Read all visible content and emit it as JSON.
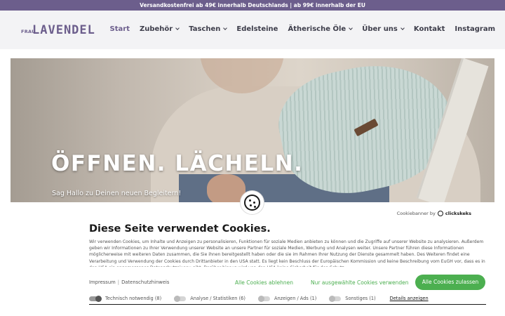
{
  "topbar": {
    "text": "Versandkostenfrei ab 49€ innerhalb Deutschlands | ab 99€ innerhalb der EU"
  },
  "logo": {
    "prefix": "FRAU",
    "name": "LAVENDEL"
  },
  "nav": {
    "items": [
      {
        "label": "Start",
        "active": true,
        "dropdown": false
      },
      {
        "label": "Zubehör",
        "active": false,
        "dropdown": true
      },
      {
        "label": "Taschen",
        "active": false,
        "dropdown": true
      },
      {
        "label": "Edelsteine",
        "active": false,
        "dropdown": false
      },
      {
        "label": "Ätherische Öle",
        "active": false,
        "dropdown": true
      },
      {
        "label": "Über uns",
        "active": false,
        "dropdown": true
      },
      {
        "label": "Kontakt",
        "active": false,
        "dropdown": false
      },
      {
        "label": "Instagram",
        "active": false,
        "dropdown": false
      }
    ]
  },
  "hero": {
    "headline": "ÖFFNEN. LÄCHELN.",
    "subline": "Sag Hallo zu Deinen neuen Begleitern!"
  },
  "cookie_banner": {
    "brand_prefix": "Cookiebanner by",
    "brand_name": "clickskeks",
    "title": "Diese Seite verwendet Cookies.",
    "body": "Wir verwenden Cookies, um Inhalte und Anzeigen zu personalisieren, Funktionen für soziale Medien anbieten zu können und die Zugriffe auf unserer Website zu analysieren. Außerdem geben wir Informationen zu Ihrer Verwendung unserer Website an unsere Partner für soziale Medien, Werbung und Analysen weiter. Unsere Partner führen diese Informationen möglicherweise mit weiteren Daten zusammen, die Sie ihnen bereitgestellt haben oder die sie im Rahmen Ihrer Nutzung der Dienste gesammelt haben. Des Weiteren findet eine Verarbeitung und Verwendung der Cookies durch Drittanbieter in den USA statt. Es liegt kein Beschluss der Europäischen Kommission und keine Beschreibung vom EuGH vor, dass es in den USA ein angemessenes Datenschutzniveau gibt. Darüber hinaus wird von den USA keine Sicherheit für den Schutz",
    "link_impressum": "Impressum",
    "link_separator": "|",
    "link_datenschutz": "Datenschutzhinweis",
    "reject_label": "Alle Cookies ablehnen",
    "selected_label": "Nur ausgewählte Cookies verwenden",
    "accept_label": "Alle Cookies zulassen",
    "categories": [
      {
        "label": "Technisch notwendig",
        "count": "(8)",
        "on": true
      },
      {
        "label": "Analyse / Statistiken",
        "count": "(6)",
        "on": false
      },
      {
        "label": "Anzeigen / Ads",
        "count": "(1)",
        "on": false
      },
      {
        "label": "Sonstiges",
        "count": "(1)",
        "on": false
      }
    ],
    "details_label": "Details anzeigen",
    "accent_color": "#4caf50"
  },
  "colors": {
    "brand": "#6c5e8c",
    "topbar_bg": "#6c5e8c",
    "header_bg": "#f3f3f5"
  }
}
